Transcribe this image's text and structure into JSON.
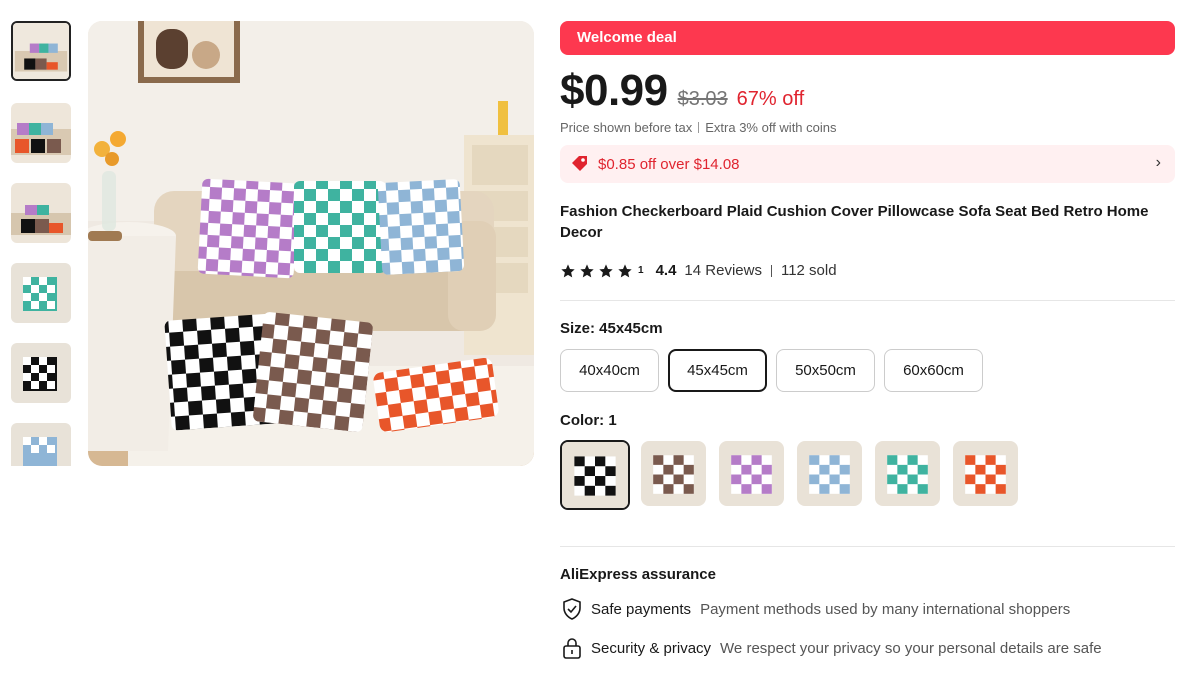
{
  "gallery": {
    "thumbnails": [
      {
        "name": "thumb-living-room-multi",
        "icon": "pillow-photo"
      },
      {
        "name": "thumb-sofa-close",
        "icon": "pillow-photo"
      },
      {
        "name": "thumb-sofa-side",
        "icon": "pillow-photo"
      },
      {
        "name": "thumb-teal-pillow",
        "icon": "pillow-photo"
      },
      {
        "name": "thumb-black-pillow",
        "icon": "pillow-photo"
      },
      {
        "name": "thumb-blue-pillow",
        "icon": "pillow-photo"
      }
    ]
  },
  "deal": {
    "banner": "Welcome deal"
  },
  "price": {
    "current": "$0.99",
    "original": "$3.03",
    "discount": "67% off",
    "note_tax": "Price shown before tax",
    "note_coins": "Extra 3% off with coins"
  },
  "coupon": {
    "text": "$0.85 off over $14.08",
    "arrow": "›"
  },
  "product": {
    "title": "Fashion Checkerboard Plaid Cushion Cover Pillowcase Sofa Seat Bed Retro Home Decor",
    "rating_partial": "1",
    "rating": "4.4",
    "reviews": "14 Reviews",
    "sold": "112 sold"
  },
  "size": {
    "label": "Size: 45x45cm",
    "options": [
      "40x40cm",
      "45x45cm",
      "50x50cm",
      "60x60cm"
    ],
    "selected_index": 1
  },
  "color": {
    "label": "Color: 1",
    "swatches": [
      "#111111",
      "#7a5a4e",
      "#b57cc8",
      "#8fb5d6",
      "#3fb3a0",
      "#e8562a"
    ],
    "selected_index": 0
  },
  "assurance": {
    "title": "AliExpress assurance",
    "items": [
      {
        "icon": "shield-check-icon",
        "name": "Safe payments",
        "desc": "Payment methods used by many international shoppers"
      },
      {
        "icon": "lock-icon",
        "name": "Security & privacy",
        "desc": "We respect your privacy so your personal details are safe"
      }
    ]
  },
  "colors": {
    "accent": "#fd384f",
    "discount": "#e0242f",
    "coupon_bg": "#fff0f1"
  }
}
